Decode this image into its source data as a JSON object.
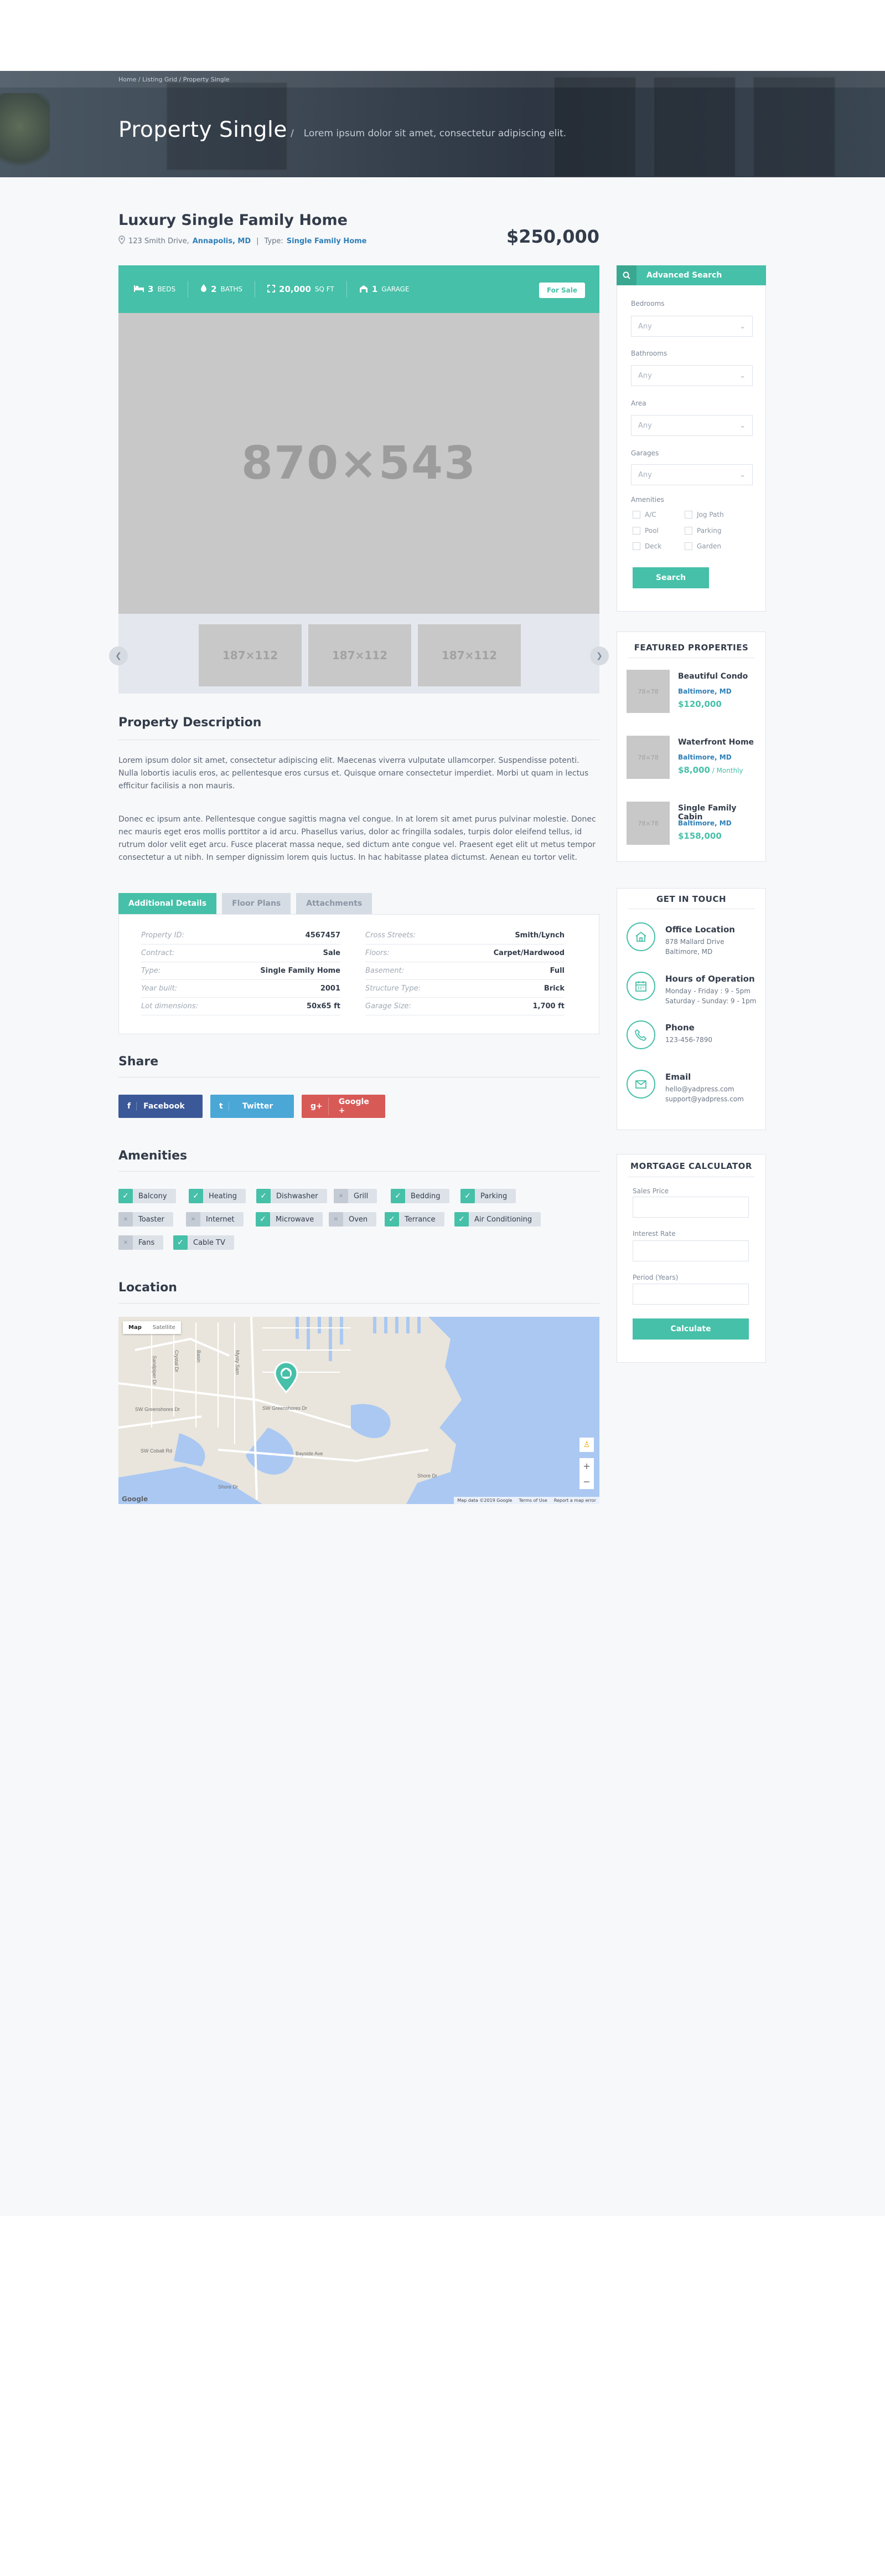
{
  "hero": {
    "breadcrumb": "Home / Listing Grid / Property Single",
    "title": "Property Single",
    "separator": "/",
    "subtitle": "Lorem ipsum dolor sit amet, consectetur adipiscing elit."
  },
  "property": {
    "title": "Luxury Single Family Home",
    "address": "123 Smith Drive,",
    "city": "Annapolis, MD",
    "divider": "|",
    "type_label": "Type:",
    "type_value": "Single Family Home",
    "price": "$250,000",
    "status": "For Sale",
    "stats": [
      {
        "icon": "bed-icon",
        "value": "3",
        "unit": "BEDS"
      },
      {
        "icon": "bath-icon",
        "value": "2",
        "unit": "BATHS"
      },
      {
        "icon": "area-icon",
        "value": "20,000",
        "unit": "SQ FT"
      },
      {
        "icon": "garage-icon",
        "value": "1",
        "unit": "GARAGE"
      }
    ],
    "main_image": "870×543",
    "thumbnails": [
      "187×112",
      "187×112",
      "187×112"
    ]
  },
  "description": {
    "heading": "Property Description",
    "p1": "Lorem ipsum dolor sit amet, consectetur adipiscing elit. Maecenas viverra vulputate ullamcorper. Suspendisse potenti. Nulla lobortis iaculis eros, ac pellentesque eros cursus et. Quisque ornare consectetur imperdiet. Morbi ut quam in lectus efficitur facilisis a non mauris.",
    "p2": "Donec ec ipsum ante. Pellentesque congue sagittis magna vel congue. In at lorem sit amet purus pulvinar molestie. Donec nec mauris eget eros mollis porttitor a id arcu. Phasellus varius, dolor ac fringilla sodales, turpis dolor eleifend tellus, id rutrum dolor velit eget arcu. Fusce placerat massa neque, sed dictum ante congue vel. Praesent eget elit ut metus tempor consectetur a ut nibh. In semper dignissim lorem quis luctus. In hac habitasse platea dictumst. Aenean eu tortor velit."
  },
  "tabs": [
    "Additional Details",
    "Floor Plans",
    "Attachments"
  ],
  "details": {
    "left": [
      {
        "k": "Property ID:",
        "v": "4567457"
      },
      {
        "k": "Contract:",
        "v": "Sale"
      },
      {
        "k": "Type:",
        "v": "Single Family Home"
      },
      {
        "k": "Year built:",
        "v": "2001"
      },
      {
        "k": "Lot dimensions:",
        "v": "50x65 ft"
      }
    ],
    "right": [
      {
        "k": "Cross Streets:",
        "v": "Smith/Lynch"
      },
      {
        "k": "Floors:",
        "v": "Carpet/Hardwood"
      },
      {
        "k": "Basement:",
        "v": "Full"
      },
      {
        "k": "Structure Type:",
        "v": "Brick"
      },
      {
        "k": "Garage Size:",
        "v": "1,700 ft"
      }
    ]
  },
  "share": {
    "heading": "Share",
    "buttons": [
      {
        "icon": "facebook-icon",
        "glyph": "f",
        "label": "Facebook",
        "color": "#3b5998"
      },
      {
        "icon": "twitter-icon",
        "glyph": "t",
        "label": "Twitter",
        "color": "#4ba7d6"
      },
      {
        "icon": "google-plus-icon",
        "glyph": "g+",
        "label": "Google +",
        "color": "#d85a57"
      }
    ]
  },
  "amenities": {
    "heading": "Amenities",
    "items": [
      {
        "label": "Balcony",
        "on": true
      },
      {
        "label": "Heating",
        "on": true
      },
      {
        "label": "Dishwasher",
        "on": true
      },
      {
        "label": "Grill",
        "on": false
      },
      {
        "label": "Bedding",
        "on": true
      },
      {
        "label": "Parking",
        "on": true
      },
      {
        "label": "Toaster",
        "on": false
      },
      {
        "label": "Internet",
        "on": false
      },
      {
        "label": "Microwave",
        "on": true
      },
      {
        "label": "Oven",
        "on": false
      },
      {
        "label": "Terrance",
        "on": true
      },
      {
        "label": "Air Conditioning",
        "on": true
      },
      {
        "label": "Fans",
        "on": false
      },
      {
        "label": "Cable TV",
        "on": true
      }
    ]
  },
  "location": {
    "heading": "Location",
    "map_tab": "Map",
    "satellite_tab": "Satellite",
    "attribution": "Map data ©2019 Google",
    "terms": "Terms of Use",
    "report": "Report a map error",
    "google": "Google",
    "zoom_in": "+",
    "zoom_out": "−",
    "street_1": "Sandpiper Dr",
    "street_2": "Crystal Dr",
    "street_3": "Basin",
    "street_4": "Mysty Sam",
    "street_5": "SW Greenshores Dr",
    "street_6": "SW Greenshores Dr",
    "street_7": "Bayside Ave",
    "street_8": "Shore Dr",
    "street_9": "SW Cobalt Rd",
    "street_10": "Shore Dr"
  },
  "search": {
    "heading": "Advanced Search",
    "fields": [
      {
        "label": "Bedrooms",
        "value": "Any"
      },
      {
        "label": "Bathrooms",
        "value": "Any"
      },
      {
        "label": "Area",
        "value": "Any"
      },
      {
        "label": "Garages",
        "value": "Any"
      }
    ],
    "amenities_label": "Amenities",
    "amenities": [
      "A/C",
      "Jog Path",
      "Pool",
      "Parking",
      "Deck",
      "Garden"
    ],
    "button": "Search"
  },
  "featured": {
    "heading": "FEATURED PROPERTIES",
    "items": [
      {
        "title": "Beautiful Condo",
        "location": "Baltimore, MD",
        "price": "$120,000",
        "suffix": "",
        "img": "78×78"
      },
      {
        "title": "Waterfront Home",
        "location": "Baltimore, MD",
        "price": "$8,000",
        "suffix": " / Monthly",
        "img": "78×78"
      },
      {
        "title": "Single Family Cabin",
        "location": "Baltimore, MD",
        "price": "$158,000",
        "suffix": "",
        "img": "78×78"
      }
    ]
  },
  "contact": {
    "heading": "GET IN TOUCH",
    "items": [
      {
        "icon": "home-icon",
        "title": "Office Location",
        "l1": "878 Mallard Drive",
        "l2": "Baltimore, MD"
      },
      {
        "icon": "calendar-icon",
        "title": "Hours of Operation",
        "l1": "Monday - Friday : 9 - 5pm",
        "l2": "Saturday - Sunday: 9 - 1pm"
      },
      {
        "icon": "phone-icon",
        "title": "Phone",
        "l1": "123-456-7890",
        "l2": ""
      },
      {
        "icon": "email-icon",
        "title": "Email",
        "l1": "hello@yadpress.com",
        "l2": "support@yadpress.com"
      }
    ]
  },
  "mortgage": {
    "heading": "MORTGAGE CALCULATOR",
    "fields": [
      "Sales Price",
      "Interest Rate",
      "Period (Years)"
    ],
    "button": "Calculate"
  },
  "colors": {
    "accent": "#46c0a8",
    "link": "#2f7fb8",
    "dark": "#333c4a"
  }
}
